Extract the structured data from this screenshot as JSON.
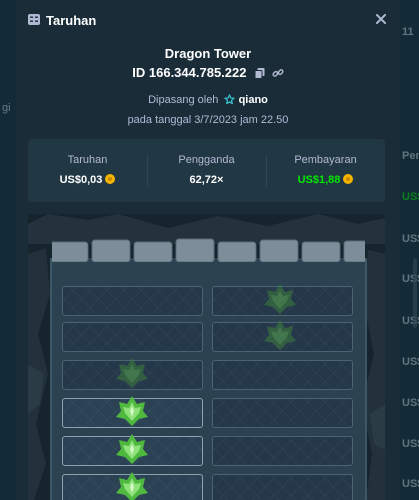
{
  "modal": {
    "title": "Taruhan",
    "game_name": "Dragon Tower",
    "bet_id": "ID 166.344.785.222",
    "placed_by_prefix": "Dipasang oleh",
    "username": "qiano",
    "placed_on": "pada tanggal 3/7/2023 jam 22.50"
  },
  "stats": {
    "bet_label": "Taruhan",
    "bet_value": "US$0,03",
    "multiplier_label": "Pengganda",
    "multiplier_value": "62,72×",
    "payout_label": "Pembayaran",
    "payout_value": "US$1,88"
  },
  "background": {
    "left_text": "gi",
    "right_items": [
      "11",
      "Pem",
      "US$",
      "US$",
      "US$",
      "US$",
      "US$",
      "US$",
      "US$",
      "US$"
    ]
  },
  "icons": {
    "title": "bet-slip-icon",
    "close": "close-icon",
    "copy": "copy-icon",
    "link": "link-icon",
    "vip": "star-icon",
    "coin": "coin-icon",
    "egg": "dragon-egg-icon"
  },
  "colors": {
    "modal_bg": "#1a2c38",
    "stats_bg": "#213743",
    "payout_green": "#00e701",
    "muted_text": "#b1bad3"
  }
}
